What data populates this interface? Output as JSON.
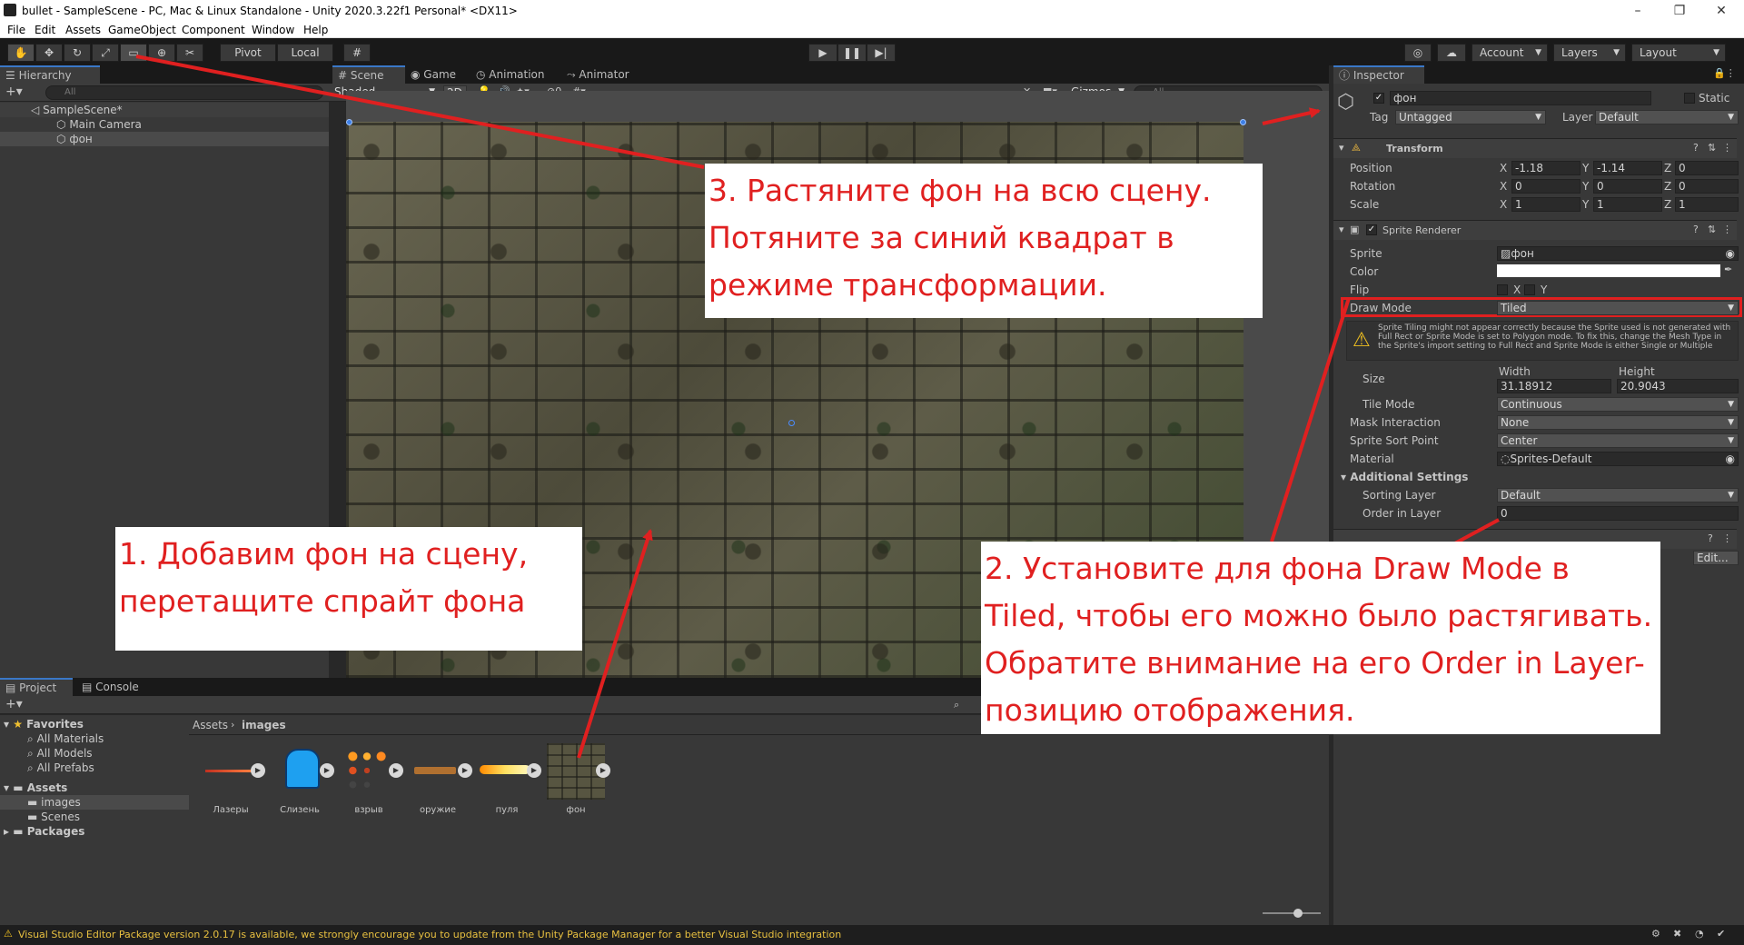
{
  "window": {
    "title": "bullet - SampleScene - PC, Mac & Linux Standalone - Unity 2020.3.22f1 Personal* <DX11>",
    "minimize": "–",
    "maximize": "❐",
    "close": "✕"
  },
  "menu": [
    "File",
    "Edit",
    "Assets",
    "GameObject",
    "Component",
    "Window",
    "Help"
  ],
  "toolbar": {
    "pivot": "Pivot",
    "local": "Local",
    "account": "Account",
    "layers": "Layers",
    "layout": "Layout"
  },
  "hierarchy": {
    "tab": "Hierarchy",
    "search_placeholder": "All",
    "scene": "SampleScene*",
    "items": [
      "Main Camera",
      "фон"
    ]
  },
  "scene": {
    "tabs": [
      "Scene",
      "Game",
      "Animation",
      "Animator"
    ],
    "shading": "Shaded",
    "mode_2d": "2D",
    "fx_count": "0",
    "gizmos": "Gizmos",
    "search_placeholder": "All"
  },
  "annotations": {
    "note1": "1. Добавим фон на сцену, перетащите спрайт фона",
    "note2": "2. Установите для фона Draw Mode в Tiled, чтобы его можно было растягивать. Обратите внимание на его Order in Layer-позицию отображения.",
    "note3": "3. Растяните фон на всю сцену. Потяните за синий квадрат в режиме трансформации.",
    "arrow_color": "#e02020"
  },
  "inspector": {
    "tab": "Inspector",
    "object_name": "фон",
    "static_label": "Static",
    "tag_label": "Tag",
    "tag_value": "Untagged",
    "layer_label": "Layer",
    "layer_value": "Default",
    "transform": {
      "title": "Transform",
      "position_label": "Position",
      "rotation_label": "Rotation",
      "scale_label": "Scale",
      "axis_x": "X",
      "axis_y": "Y",
      "axis_z": "Z",
      "position": [
        "-1.18",
        "-1.14",
        "0"
      ],
      "rotation": [
        "0",
        "0",
        "0"
      ],
      "scale": [
        "1",
        "1",
        "1"
      ]
    },
    "sprite_renderer": {
      "title": "Sprite Renderer",
      "sprite_label": "Sprite",
      "sprite_value": "фон",
      "color_label": "Color",
      "flip_label": "Flip",
      "flip_x": "X",
      "flip_y": "Y",
      "draw_mode_label": "Draw Mode",
      "draw_mode_value": "Tiled",
      "warning": "Sprite Tiling might not appear correctly because the Sprite used is not generated with Full Rect or Sprite Mode is set to Polygon mode. To fix this, change the Mesh Type in the Sprite's import setting to Full Rect and Sprite Mode is either Single or Multiple",
      "size_label": "Size",
      "width_label": "Width",
      "height_label": "Height",
      "width": "31.18912",
      "height": "20.9043",
      "tile_mode_label": "Tile Mode",
      "tile_mode_value": "Continuous",
      "mask_label": "Mask Interaction",
      "mask_value": "None",
      "sort_point_label": "Sprite Sort Point",
      "sort_point_value": "Center",
      "material_label": "Material",
      "material_value": "Sprites-Default",
      "additional_label": "Additional Settings",
      "sorting_layer_label": "Sorting Layer",
      "sorting_layer_value": "Default",
      "order_label": "Order in Layer",
      "order_value": "0"
    },
    "edit_button": "Edit..."
  },
  "project": {
    "tabs": [
      "Project",
      "Console"
    ],
    "favorites": "Favorites",
    "favorite_items": [
      "All Materials",
      "All Models",
      "All Prefabs"
    ],
    "assets": "Assets",
    "asset_folders": [
      "images",
      "Scenes"
    ],
    "packages": "Packages",
    "breadcrumb": [
      "Assets",
      "images"
    ],
    "files": [
      "Лазеры",
      "Слизень",
      "взрыв",
      "оружие",
      "пуля",
      "фон"
    ]
  },
  "status": {
    "message": "Visual Studio Editor Package version 2.0.17 is available, we strongly encourage you to update from the Unity Package Manager for a better Visual Studio integration"
  }
}
